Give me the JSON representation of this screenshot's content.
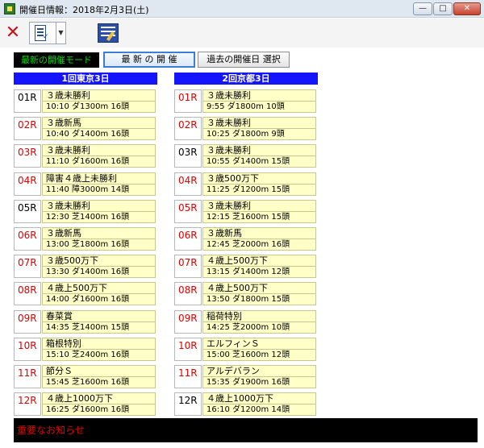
{
  "window": {
    "title": "開催日情報：2018年2月3日(土)",
    "minimize_label": "—",
    "maximize_label": "□",
    "close_label": "✕"
  },
  "toolbar": {
    "close_icon": "✕",
    "dropdown_glyph": "▼"
  },
  "mode": {
    "label": "最新の開催モード",
    "latest_button": "最 新 の 開 催",
    "past_button": "過去の開催日 選択"
  },
  "venues": [
    {
      "name": "1回東京3日",
      "races": [
        {
          "num": "01R",
          "num_color": "black",
          "name": "３歳未勝利",
          "detail": "10:10 ダ1300m 16頭"
        },
        {
          "num": "02R",
          "num_color": "red",
          "name": "３歳新馬",
          "detail": "10:40 ダ1400m 16頭"
        },
        {
          "num": "03R",
          "num_color": "red",
          "name": "３歳未勝利",
          "detail": "11:10 ダ1600m 16頭"
        },
        {
          "num": "04R",
          "num_color": "red",
          "name": "障害４歳上未勝利",
          "detail": "11:40 障3000m 14頭"
        },
        {
          "num": "05R",
          "num_color": "black",
          "name": "３歳未勝利",
          "detail": "12:30 芝1400m 16頭"
        },
        {
          "num": "06R",
          "num_color": "red",
          "name": "３歳新馬",
          "detail": "13:00 芝1800m 16頭"
        },
        {
          "num": "07R",
          "num_color": "red",
          "name": "３歳500万下",
          "detail": "13:30 ダ1400m 16頭"
        },
        {
          "num": "08R",
          "num_color": "red",
          "name": "４歳上500万下",
          "detail": "14:00 ダ1600m 16頭"
        },
        {
          "num": "09R",
          "num_color": "red",
          "name": "春菜賞",
          "detail": "14:35 芝1400m 15頭"
        },
        {
          "num": "10R",
          "num_color": "red",
          "name": "箱根特別",
          "detail": "15:10 芝2400m 16頭"
        },
        {
          "num": "11R",
          "num_color": "red",
          "name": "節分Ｓ",
          "detail": "15:45 芝1600m 16頭"
        },
        {
          "num": "12R",
          "num_color": "red",
          "name": "４歳上1000万下",
          "detail": "16:25 ダ1600m 16頭"
        }
      ]
    },
    {
      "name": "2回京都3日",
      "races": [
        {
          "num": "01R",
          "num_color": "red",
          "name": "３歳未勝利",
          "detail": "9:55 ダ1800m 10頭"
        },
        {
          "num": "02R",
          "num_color": "red",
          "name": "３歳未勝利",
          "detail": "10:25 ダ1800m 9頭"
        },
        {
          "num": "03R",
          "num_color": "black",
          "name": "３歳未勝利",
          "detail": "10:55 ダ1400m 15頭"
        },
        {
          "num": "04R",
          "num_color": "red",
          "name": "３歳500万下",
          "detail": "11:25 ダ1200m 15頭"
        },
        {
          "num": "05R",
          "num_color": "red",
          "name": "３歳未勝利",
          "detail": "12:15 芝1600m 15頭"
        },
        {
          "num": "06R",
          "num_color": "red",
          "name": "３歳新馬",
          "detail": "12:45 芝2000m 16頭"
        },
        {
          "num": "07R",
          "num_color": "red",
          "name": "４歳上500万下",
          "detail": "13:15 ダ1400m 12頭"
        },
        {
          "num": "08R",
          "num_color": "red",
          "name": "４歳上500万下",
          "detail": "13:50 ダ1800m 15頭"
        },
        {
          "num": "09R",
          "num_color": "red",
          "name": "稲荷特別",
          "detail": "14:25 芝2000m 10頭"
        },
        {
          "num": "10R",
          "num_color": "red",
          "name": "エルフィンＳ",
          "detail": "15:00 芝1600m 12頭"
        },
        {
          "num": "11R",
          "num_color": "red",
          "name": "アルデバラン",
          "detail": "15:35 ダ1900m 16頭"
        },
        {
          "num": "12R",
          "num_color": "black",
          "name": "４歳上1000万下",
          "detail": "16:10 ダ1200m 14頭"
        }
      ]
    }
  ],
  "notice": {
    "label": "重要なお知らせ"
  },
  "colors": {
    "venue_header_bg": "#1414ff",
    "race_name_bg": "#ffffc8",
    "race_num_red": "#e00000",
    "mode_label_text": "#00dd00",
    "notice_text": "#e00000"
  },
  "icons": {
    "app": "app-icon",
    "close": "close-icon",
    "report": "report-icon",
    "dropdown": "chevron-down-icon",
    "edit": "edit-icon"
  }
}
